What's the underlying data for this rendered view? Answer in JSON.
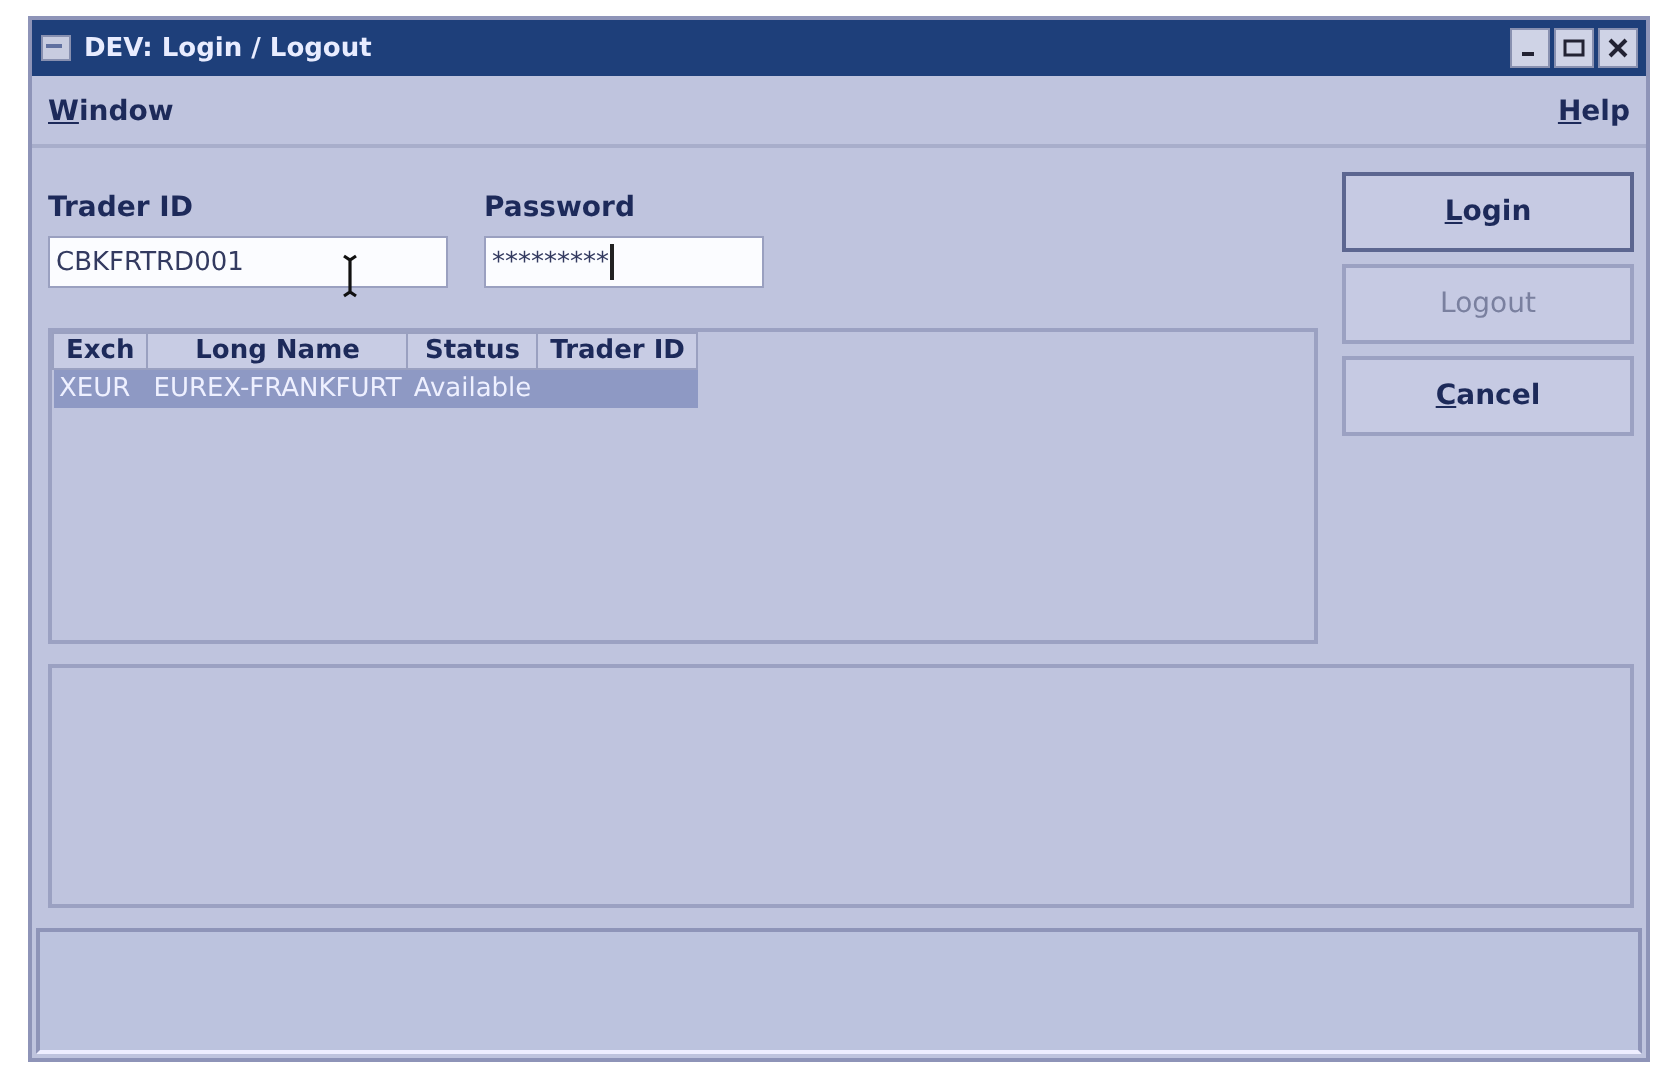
{
  "window": {
    "title": "DEV: Login / Logout"
  },
  "menu": [
    {
      "label": "Window"
    },
    {
      "label": "Help"
    }
  ],
  "fields": [
    {
      "label": "Trader ID",
      "value": "CBKFRTRD001",
      "pointer": true
    },
    {
      "label": "Password",
      "value": "*********",
      "caret": true
    }
  ],
  "table": {
    "columns": [
      "Exch",
      "Long Name",
      "Status",
      "Trader ID"
    ],
    "rows": [
      {
        "cells": [
          "XEUR",
          "EUREX-FRANKFURT",
          "Available"
        ],
        "selected": true
      }
    ]
  },
  "buttons": [
    {
      "label": "Login",
      "disabled": false,
      "focused": true
    },
    {
      "label": "Logout",
      "disabled": true,
      "focused": false
    },
    {
      "label": "Cancel",
      "disabled": false,
      "focused": false
    }
  ]
}
